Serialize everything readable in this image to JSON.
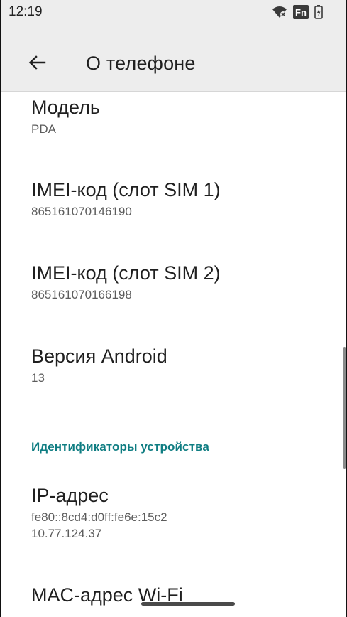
{
  "status_bar": {
    "time": "12:19",
    "icons": [
      "wifi-icon",
      "fn-icon",
      "battery-icon"
    ],
    "fn_label": "Fn"
  },
  "app_bar": {
    "back_icon": "arrow-back-icon",
    "title": "О телефоне"
  },
  "items": [
    {
      "title": "Модель",
      "summary": "PDA"
    },
    {
      "title": "IMEI-код (слот SIM 1)",
      "summary": "865161070146190"
    },
    {
      "title": "IMEI-код (слот SIM 2)",
      "summary": "865161070166198"
    },
    {
      "title": "Версия Android",
      "summary": "13"
    }
  ],
  "category": "Идентификаторы устройства",
  "ip_item": {
    "title": "IP-адрес",
    "summary_line1": "fe80::8cd4:d0ff:fe6e:15c2",
    "summary_line2": "10.77.124.37"
  },
  "mac_item": {
    "title": "MAC-адрес Wi-Fi"
  },
  "colors": {
    "accent": "#0f7d82",
    "bar_background": "#ededed"
  }
}
